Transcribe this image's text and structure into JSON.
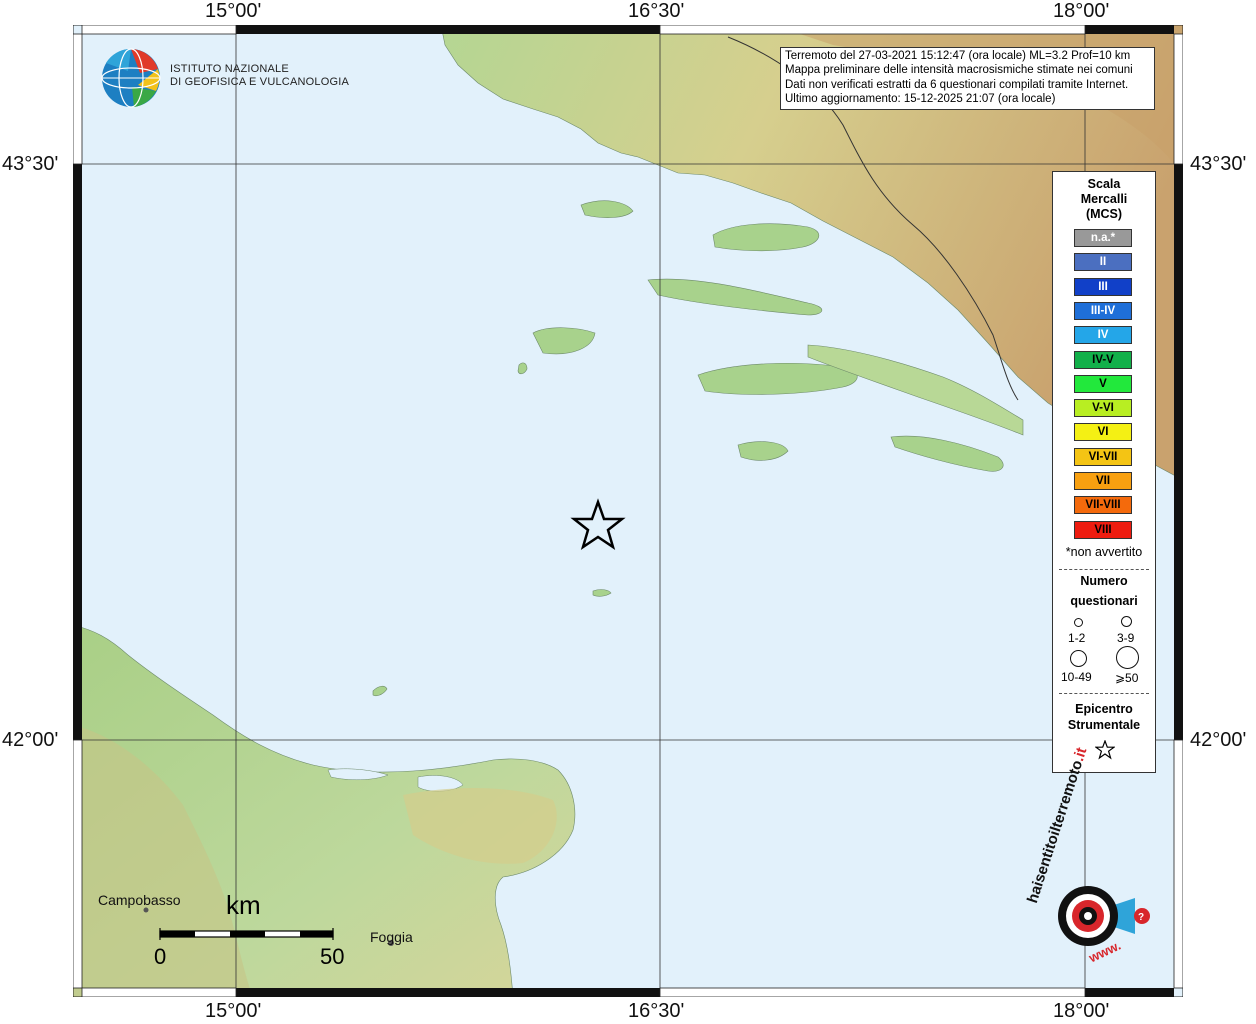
{
  "map": {
    "lon_labels_top": [
      "15°00'",
      "16°30'",
      "18°00'"
    ],
    "lon_labels_bottom": [
      "15°00'",
      "16°30'",
      "18°00'"
    ],
    "lat_labels_left": [
      "43°30'",
      "42°00'"
    ],
    "lat_labels_right": [
      "43°30'",
      "42°00'"
    ],
    "colors": {
      "sea": "#e2f1fb",
      "land_low": "#9ec87f",
      "land_mid": "#d8cf8f",
      "land_high": "#c99c6b",
      "grid": "#333333"
    }
  },
  "logo_ingv": {
    "line1": "ISTITUTO NAZIONALE",
    "line2": "DI GEOFISICA E VULCANOLOGIA"
  },
  "info": {
    "line1": "Terremoto del 27-03-2021 15:12:47 (ora locale) ML=3.2 Prof=10 km",
    "line2": "Mappa preliminare delle intensità macrosismiche stimate nei comuni",
    "line3": "Dati non verificati estratti da 6 questionari compilati tramite Internet.",
    "line4": "Ultimo aggiornamento: 15-12-2025 21:07 (ora locale)"
  },
  "legend": {
    "title1": "Scala",
    "title2": "Mercalli",
    "title3": "(MCS)",
    "mcs": [
      {
        "label": "n.a.*",
        "color": "#999999",
        "text": "#ffffff"
      },
      {
        "label": "II",
        "color": "#4b6fc0",
        "text": "#ffffff"
      },
      {
        "label": "III",
        "color": "#1140c8",
        "text": "#ffffff"
      },
      {
        "label": "III-IV",
        "color": "#1f6fd8",
        "text": "#ffffff"
      },
      {
        "label": "IV",
        "color": "#24a6e8",
        "text": "#ffffff"
      },
      {
        "label": "IV-V",
        "color": "#12b04a",
        "text": "#000000"
      },
      {
        "label": "V",
        "color": "#22e83c",
        "text": "#000000"
      },
      {
        "label": "V-VI",
        "color": "#b8ee22",
        "text": "#000000"
      },
      {
        "label": "VI",
        "color": "#f4f014",
        "text": "#000000"
      },
      {
        "label": "VI-VII",
        "color": "#f4c414",
        "text": "#000000"
      },
      {
        "label": "VII",
        "color": "#f8a010",
        "text": "#000000"
      },
      {
        "label": "VII-VIII",
        "color": "#f46a0c",
        "text": "#000000"
      },
      {
        "label": "VIII",
        "color": "#ee1c10",
        "text": "#000000"
      }
    ],
    "not_felt_note": "*non avvertito",
    "questionnaires_title1": "Numero",
    "questionnaires_title2": "questionari",
    "q_sizes": [
      "1-2",
      "3-9",
      "10-49",
      "⩾50"
    ],
    "epicenter_title1": "Epicentro",
    "epicenter_title2": "Strumentale"
  },
  "places": {
    "campobasso": "Campobasso",
    "foggia": "Foggia"
  },
  "scalebar": {
    "unit": "km",
    "start": "0",
    "end": "50"
  },
  "logo_hst": {
    "text_main": "haisentitoilterremoto",
    "text_tld": ".it",
    "text_www": "www."
  }
}
